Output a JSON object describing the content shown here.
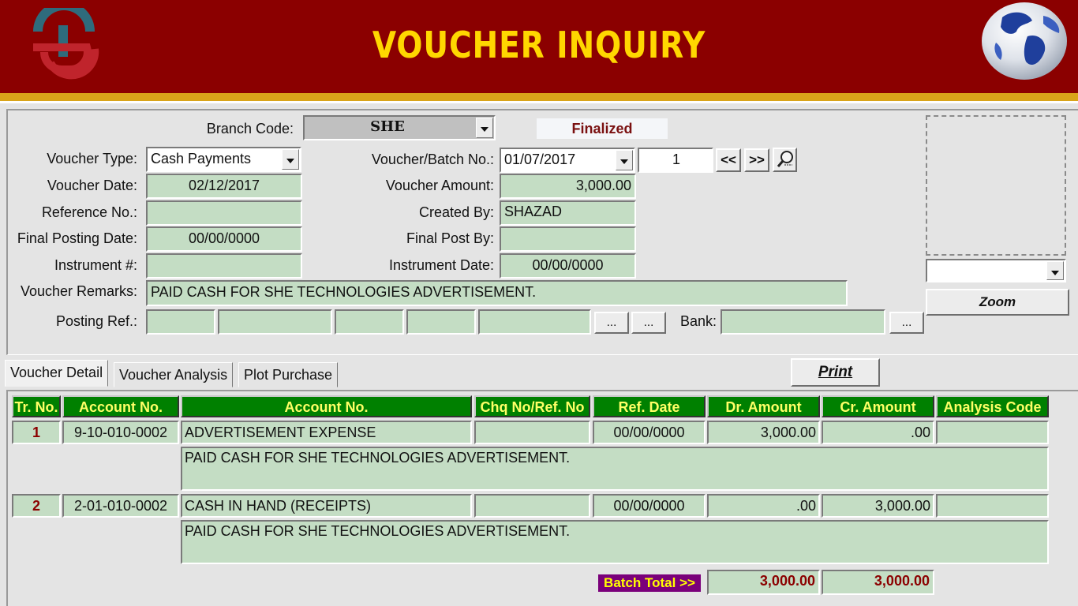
{
  "header": {
    "title": "VOUCHER INQUIRY",
    "logo_icon": "company-logo-icon",
    "globe_icon": "globe-icon",
    "bg_color": "#8b0000",
    "title_color": "#ffd700"
  },
  "form": {
    "branch_code": {
      "label": "Branch Code:",
      "value": "SHE"
    },
    "status": "Finalized",
    "voucher_type": {
      "label": "Voucher Type:",
      "value": "Cash Payments"
    },
    "voucher_batch_no": {
      "label": "Voucher/Batch No.:",
      "date": "01/07/2017",
      "number": "1"
    },
    "prev_label": "<<",
    "next_label": ">>",
    "search_icon": "search-icon",
    "voucher_date": {
      "label": "Voucher Date:",
      "value": "02/12/2017"
    },
    "voucher_amount": {
      "label": "Voucher Amount:",
      "value": "3,000.00"
    },
    "reference_no": {
      "label": "Reference No.:",
      "value": ""
    },
    "created_by": {
      "label": "Created By:",
      "value": "SHAZAD"
    },
    "final_posting_date": {
      "label": "Final Posting Date:",
      "value": "00/00/0000"
    },
    "final_post_by": {
      "label": "Final Post By:",
      "value": ""
    },
    "instrument_no": {
      "label": "Instrument #:",
      "value": ""
    },
    "instrument_date": {
      "label": "Instrument Date:",
      "value": "00/00/0000"
    },
    "voucher_remarks": {
      "label": "Voucher Remarks:",
      "value": "PAID CASH FOR SHE TECHNOLOGIES ADVERTISEMENT."
    },
    "posting_ref": {
      "label": "Posting Ref.:",
      "values": [
        "",
        "",
        "",
        "",
        ""
      ]
    },
    "ellipsis": "...",
    "bank": {
      "label": "Bank:",
      "value": ""
    },
    "zoom_label": "Zoom",
    "image_select": ""
  },
  "tabs": [
    {
      "label": "Voucher Detail",
      "active": true
    },
    {
      "label": "Voucher Analysis",
      "active": false
    },
    {
      "label": "Plot Purchase",
      "active": false
    }
  ],
  "print_label": "Print",
  "grid": {
    "headers": [
      "Tr. No.",
      "Account No.",
      "Account No.",
      "Chq No/Ref. No",
      "Ref. Date",
      "Dr. Amount",
      "Cr. Amount",
      "Analysis Code"
    ],
    "rows": [
      {
        "tr_no": "1",
        "account_code": "9-10-010-0002",
        "account_name": "ADVERTISEMENT EXPENSE",
        "chq_ref": "",
        "ref_date": "00/00/0000",
        "dr": "3,000.00",
        "cr": ".00",
        "analysis": "",
        "description": "PAID CASH FOR SHE TECHNOLOGIES ADVERTISEMENT."
      },
      {
        "tr_no": "2",
        "account_code": "2-01-010-0002",
        "account_name": "CASH IN HAND (RECEIPTS)",
        "chq_ref": "",
        "ref_date": "00/00/0000",
        "dr": ".00",
        "cr": "3,000.00",
        "analysis": "",
        "description": "PAID CASH FOR SHE TECHNOLOGIES ADVERTISEMENT."
      }
    ],
    "batch_total_label": "Batch Total >>",
    "batch_total_dr": "3,000.00",
    "batch_total_cr": "3,000.00",
    "header_bg": "#008000",
    "header_text": "#ffff66"
  }
}
